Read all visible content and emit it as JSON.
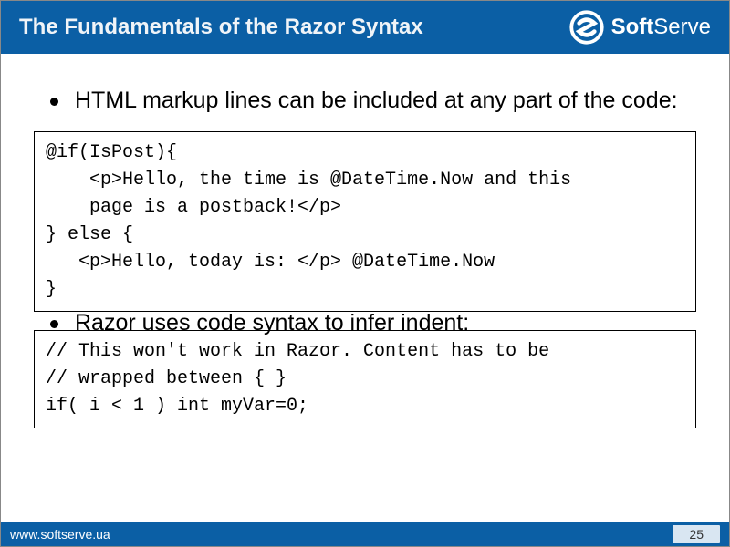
{
  "header": {
    "title": "The Fundamentals of the Razor Syntax",
    "logo_text_bold": "Soft",
    "logo_text_light": "Serve"
  },
  "content": {
    "bullet1": "HTML markup lines can be included at any part of the code:",
    "code1": "@if(IsPost){\n    <p>Hello, the time is @DateTime.Now and this\n    page is a postback!</p>\n} else { \n   <p>Hello, today is: </p> @DateTime.Now\n}",
    "bullet2": "Razor uses code syntax to infer indent:",
    "code2": "// This won't work in Razor. Content has to be \n// wrapped between { }\nif( i < 1 ) int myVar=0;"
  },
  "footer": {
    "url": "www.softserve.ua",
    "page": "25"
  }
}
